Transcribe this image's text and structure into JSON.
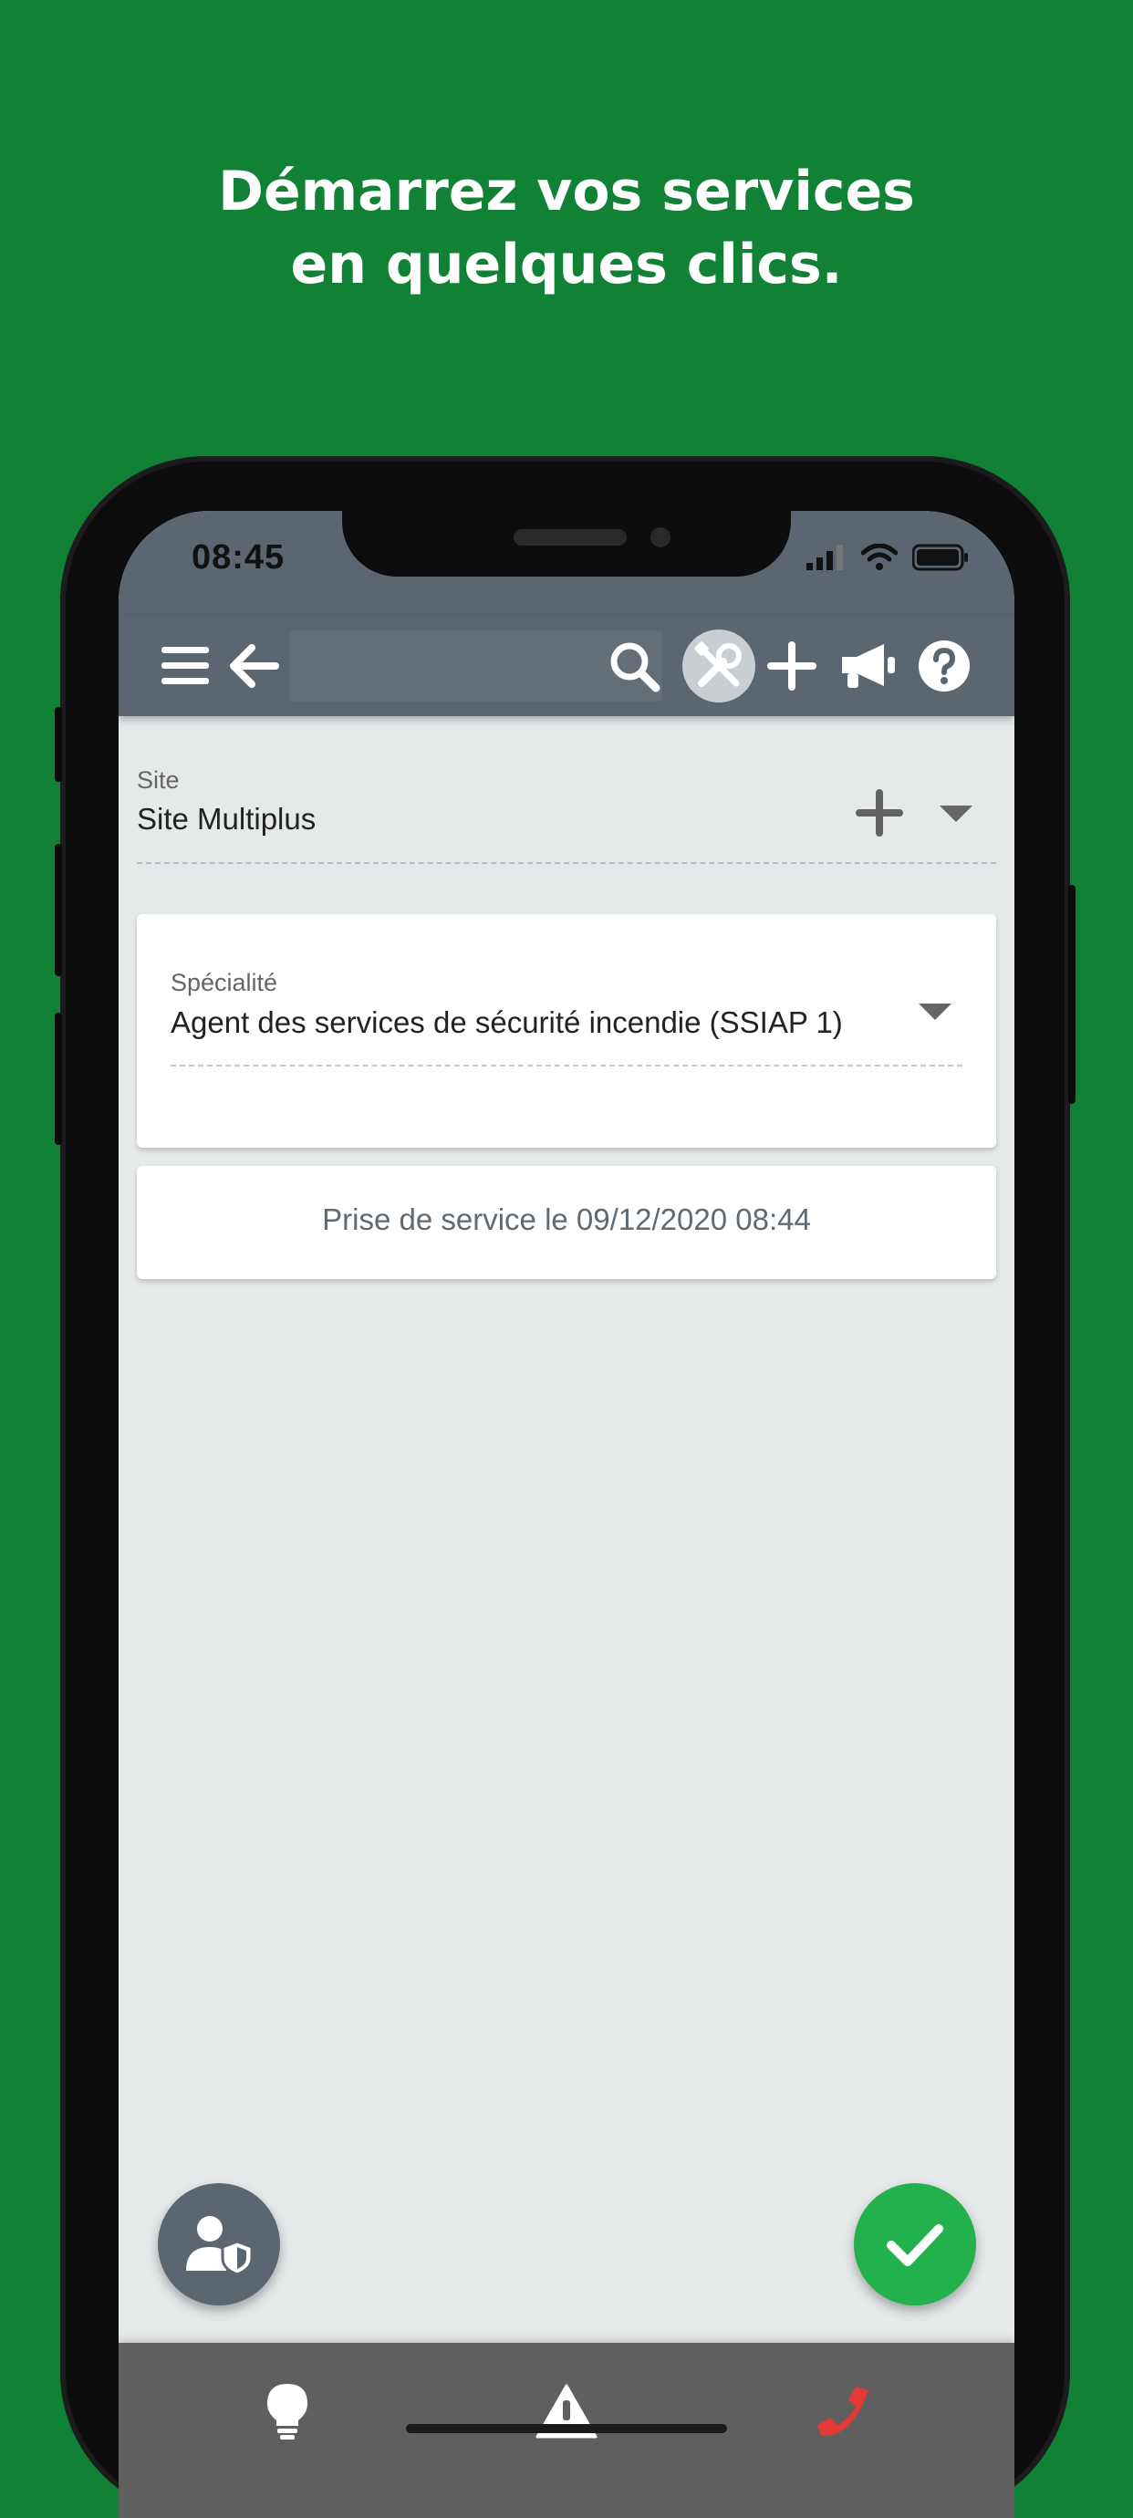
{
  "headline": {
    "line1": "Démarrez vos services",
    "line2": "en quelques clics."
  },
  "statusbar": {
    "time": "08:45",
    "icons": [
      "signal-icon",
      "wifi-icon",
      "battery-icon"
    ]
  },
  "toolbar": {
    "icons": [
      "menu-icon",
      "back-arrow-icon",
      "search-icon",
      "tools-icon",
      "add-icon",
      "megaphone-icon",
      "help-icon"
    ],
    "active": "tools-icon"
  },
  "site": {
    "label": "Site",
    "value": "Site Multiplus"
  },
  "specialite": {
    "label": "Spécialité",
    "value": "Agent des services de sécurité incendie (SSIAP 1)"
  },
  "service": {
    "text": "Prise de service le 09/12/2020 08:44"
  },
  "fabs": {
    "left": "user-shield-icon",
    "right": "check-icon"
  },
  "bottombar": {
    "icons": [
      "lightbulb-icon",
      "warning-icon",
      "phone-icon"
    ]
  },
  "colors": {
    "background": "#118235",
    "toolbar": "#5c6670",
    "confirm": "#22b14c",
    "phone_red": "#e53935",
    "bottombar": "#5f5f60"
  }
}
